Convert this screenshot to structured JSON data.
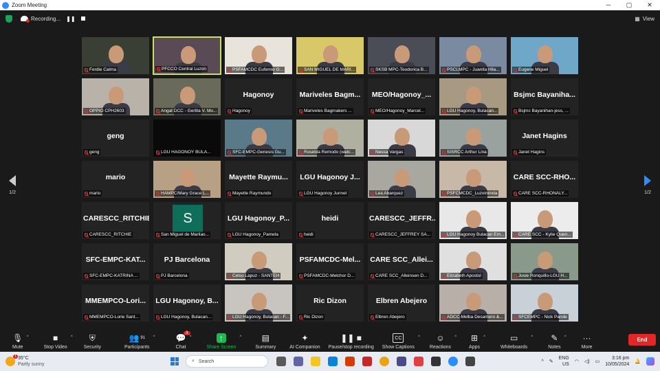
{
  "window": {
    "title": "Zoom Meeting"
  },
  "topbar": {
    "recording_label": "Recording...",
    "view_label": "View"
  },
  "pager": {
    "left": "1/2",
    "right": "1/2"
  },
  "participants": [
    {
      "name": "Ferdie Calma",
      "big": "",
      "photo": true,
      "bg": "#3a3f36"
    },
    {
      "name": "PFCCO Central Luzon",
      "big": "",
      "photo": true,
      "bg": "#5a4a55",
      "active": true
    },
    {
      "name": "PSFAMCDC Eufemio G...",
      "big": "",
      "photo": true,
      "bg": "#e8e4dc"
    },
    {
      "name": "SAN MIGUEL DE MARI...",
      "big": "",
      "photo": true,
      "bg": "#d8c86a"
    },
    {
      "name": "SKSB MPC-Teodorica B...",
      "big": "",
      "photo": true,
      "bg": "#4a4c56"
    },
    {
      "name": "PSCLMPC - Juanita Hila...",
      "big": "",
      "photo": true,
      "bg": "#7a8aa0"
    },
    {
      "name": "Eugene Miguel",
      "big": "",
      "photo": true,
      "bg": "#6fa7c8"
    },
    {
      "name": "OPPIO CPH2603",
      "big": "",
      "photo": true,
      "bg": "#b8b2a8"
    },
    {
      "name": "Angat DCC - Gerlita V. Mo...",
      "big": "",
      "photo": true,
      "bg": "#6a6a5a"
    },
    {
      "name": "Hagonoy",
      "big": "Hagonoy",
      "photo": false
    },
    {
      "name": "Mariveles Bagmakers ...",
      "big": "Mariveles  Bagm...",
      "photo": false
    },
    {
      "name": "MEO/Hagonoy_Marcel...",
      "big": "MEO/Hagonoy_...",
      "photo": false
    },
    {
      "name": "LGU Hagonoy, Bulacan...",
      "big": "",
      "photo": true,
      "bg": "#a89a82"
    },
    {
      "name": "Bsjmc Bayanihan-jess, ...",
      "big": "Bsjmc  Bayaniha...",
      "photo": false
    },
    {
      "name": "geng",
      "big": "geng",
      "photo": false
    },
    {
      "name": "LGU HAGONOY BULA...",
      "big": "",
      "photo": true,
      "bg": "#0a0a0a"
    },
    {
      "name": "SFC-EMPC-Genesis Gu...",
      "big": "",
      "photo": true,
      "bg": "#5a7a8a"
    },
    {
      "name": "Roselda Remodo (watc...",
      "big": "",
      "photo": true,
      "bg": "#b0b0a0"
    },
    {
      "name": "Nessa Vargas",
      "big": "",
      "photo": true,
      "bg": "#d8d8d8"
    },
    {
      "name": "SISRCC Arthur Lina",
      "big": "",
      "photo": true,
      "bg": "#9aa2a0"
    },
    {
      "name": "Janet Hagins",
      "big": "Janet Hagins",
      "photo": false
    },
    {
      "name": "mario",
      "big": "mario",
      "photo": false
    },
    {
      "name": "HAMPC/Mary Grace L...",
      "big": "",
      "photo": true,
      "bg": "#b8a084"
    },
    {
      "name": "Mayette Raymundo",
      "big": "Mayette  Raymu...",
      "photo": false
    },
    {
      "name": "LGU Hagonoy Junnel",
      "big": "LGU Hagonoy J...",
      "photo": false
    },
    {
      "name": "Lea Abarquez",
      "big": "",
      "photo": true,
      "bg": "#a8a8a0"
    },
    {
      "name": "PSFCMCDC_Luzviminda",
      "big": "",
      "photo": true,
      "bg": "#c8b8a8"
    },
    {
      "name": "CARE SCC-RHONALY...",
      "big": "CARE  SCC-RHO...",
      "photo": false
    },
    {
      "name": "CARESCC_RITCHIE",
      "big": "CARESCC_RITCHIE",
      "photo": false
    },
    {
      "name": "San Miguel de Marilao...",
      "big": "",
      "photo": false,
      "avatar": "S"
    },
    {
      "name": "LGU Hagonoy_Pamela",
      "big": "LGU Hagonoy_P...",
      "photo": false
    },
    {
      "name": "heidi",
      "big": "heidi",
      "photo": false
    },
    {
      "name": "CARESCC_JEFFREY SA...",
      "big": "CARESCC_JEFFR...",
      "photo": false
    },
    {
      "name": "LGU Hagonoy Bulacan Em...",
      "big": "",
      "photo": true,
      "bg": "#e8e8e8"
    },
    {
      "name": "CARE SCC - Kylie Quen...",
      "big": "",
      "photo": true,
      "bg": "#ececec"
    },
    {
      "name": "SFC-EMPC-KATRINA ...",
      "big": "SFC-EMPC-KAT...",
      "photo": false
    },
    {
      "name": "PJ Barcelona",
      "big": "PJ Barcelona",
      "photo": false
    },
    {
      "name": "Celso Lapuz - SANTEH",
      "big": "",
      "photo": true,
      "bg": "#d0ccc0"
    },
    {
      "name": "PSFAMCDC-Melchor D...",
      "big": "PSFAMCDC-Mel...",
      "photo": false
    },
    {
      "name": "CARE SCC_Alleinsen D...",
      "big": "CARE  SCC_Allei...",
      "photo": false
    },
    {
      "name": "Elizabeth Apostol",
      "big": "",
      "photo": true,
      "bg": "#e0e0e0"
    },
    {
      "name": "Josie Ronquillo-LGU H...",
      "big": "",
      "photo": true,
      "bg": "#8a9a8a"
    },
    {
      "name": "MMEMPCO-Lorie Sant...",
      "big": "MMEMPCO-Lori...",
      "photo": false
    },
    {
      "name": "LGU Hagonoy, Bulacan...",
      "big": "LGU Hagonoy, B...",
      "photo": false
    },
    {
      "name": "LGU Hagonoy, Bulacan - F...",
      "big": "",
      "photo": true,
      "bg": "#c8c4c0"
    },
    {
      "name": "Ric Dizon",
      "big": "Ric Dizon",
      "photo": false
    },
    {
      "name": "Elbren Abejero",
      "big": "Elbren Abejero",
      "photo": false
    },
    {
      "name": "ADCC-Melba Desamero &...",
      "big": "",
      "photo": true,
      "bg": "#b8b0a8"
    },
    {
      "name": "SFCEMPC - Nick Parole",
      "big": "",
      "photo": true,
      "bg": "#c8d0d8"
    }
  ],
  "toolbar": {
    "mute": "Mute",
    "stop_video": "Stop Video",
    "security": "Security",
    "participants": "Participants",
    "participants_count": "91",
    "chat": "Chat",
    "chat_badge": "3",
    "share_screen": "Share Screen",
    "summary": "Summary",
    "ai_companion": "AI Companion",
    "recording": "Pause/stop recording",
    "captions": "Show Captions",
    "reactions": "Reactions",
    "apps": "Apps",
    "whiteboards": "Whiteboards",
    "notes": "Notes",
    "more": "More",
    "end": "End"
  },
  "taskbar": {
    "temp": "35°C",
    "weather": "Partly sunny",
    "weather_badge": "1",
    "search": "Search",
    "lang": "ENG",
    "region": "US",
    "time": "3:16 pm",
    "date": "10/05/2024"
  }
}
